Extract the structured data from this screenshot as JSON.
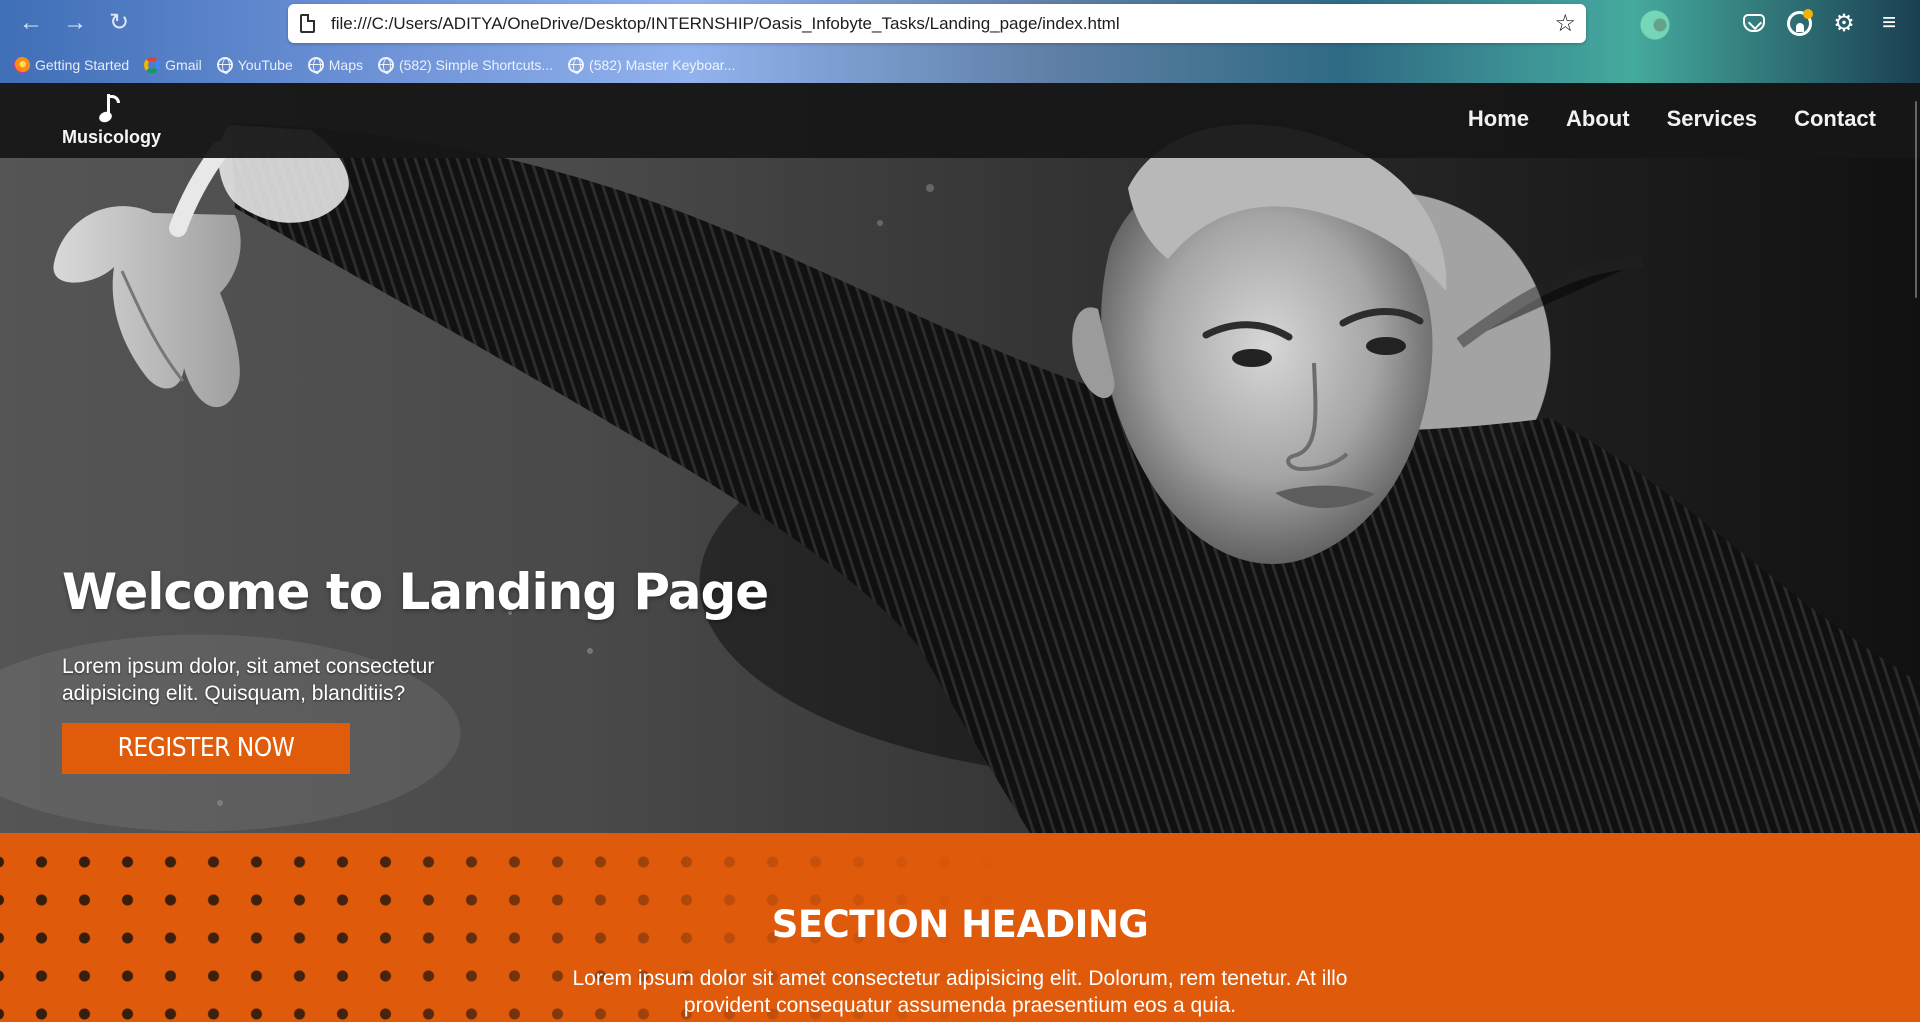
{
  "browser": {
    "back_icon": "arrow-left-icon",
    "forward_icon": "arrow-right-icon",
    "reload_icon": "reload-icon",
    "url": "file:///C:/Users/ADITYA/OneDrive/Desktop/INTERNSHIP/Oasis_Infobyte_Tasks/Landing_page/index.html",
    "bookmark_star_icon": "star-icon",
    "pocket_icon": "pocket-icon",
    "account_icon": "account-icon",
    "extensions_icon": "puzzle-icon",
    "menu_icon": "hamburger-icon",
    "bookmarks": [
      {
        "label": "Getting Started",
        "icon": "firefox-icon"
      },
      {
        "label": "Gmail",
        "icon": "google-icon"
      },
      {
        "label": "YouTube",
        "icon": "globe-icon"
      },
      {
        "label": "Maps",
        "icon": "globe-icon"
      },
      {
        "label": "(582) Simple Shortcuts...",
        "icon": "globe-icon"
      },
      {
        "label": "(582) Master Keyboar...",
        "icon": "globe-icon"
      }
    ]
  },
  "site": {
    "logo": {
      "icon": "music-note-icon",
      "text": "Musicology"
    },
    "nav": [
      {
        "label": "Home"
      },
      {
        "label": "About"
      },
      {
        "label": "Services"
      },
      {
        "label": "Contact"
      }
    ],
    "hero": {
      "title": "Welcome to Landing Page",
      "text": "Lorem ipsum dolor, sit amet consectetur adipisicing elit. Quisquam, blanditiis?",
      "button_label": "REGISTER NOW"
    },
    "section": {
      "heading": "SECTION HEADING",
      "text": "Lorem ipsum dolor sit amet consectetur adipisicing elit. Dolorum, rem tenetur. At illo provident consequatur assumenda praesentium eos a quia."
    }
  },
  "colors": {
    "accent": "#df5a0b",
    "header": "#161616",
    "text": "#ffffff"
  }
}
